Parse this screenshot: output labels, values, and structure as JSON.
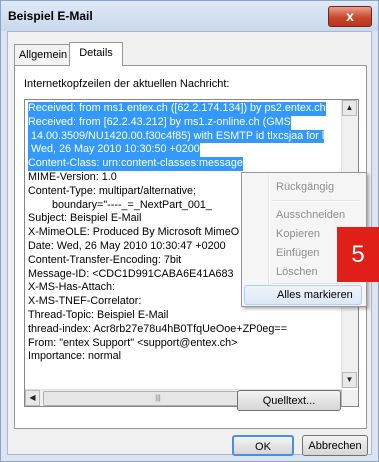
{
  "window": {
    "title": "Beispiel E-Mail",
    "close_glyph": "x"
  },
  "tabs": [
    {
      "label": "Allgemein",
      "active": false
    },
    {
      "label": "Details",
      "active": true
    }
  ],
  "details": {
    "heading": "Internetkopfzeilen der aktuellen Nachricht:",
    "header_lines": [
      "Received: from ms1.entex.ch ([62.2.174.134]) by ps2.entex.ch",
      "Received: from [62.2.43.212] by ms1.z-online.ch (GMS",
      " 14.00.3509/NU1420.00.f30c4f85) with ESMTP id tlxcsjaa for l",
      " Wed, 26 May 2010 10:30:50 +0200",
      "Content-Class: urn:content-classes:message",
      "MIME-Version: 1.0",
      "Content-Type: multipart/alternative;",
      "        boundary=\"----_=_NextPart_001_",
      "Subject: Beispiel E-Mail",
      "X-MimeOLE: Produced By Microsoft MimeO",
      "Date: Wed, 26 May 2010 10:30:47 +0200",
      "Content-Transfer-Encoding: 7bit",
      "Message-ID: <CDC1D991CABA6E41A683",
      "X-MS-Has-Attach:",
      "X-MS-TNEF-Correlator:",
      "Thread-Topic: Beispiel E-Mail",
      "thread-index: Acr8rb27e78u4hB0TfqUeOoe+ZP0eg==",
      "From: \"entex Support\" <support@entex.ch>",
      "Importance: normal"
    ],
    "source_button": "Quelltext..."
  },
  "context_menu": {
    "items": [
      {
        "label": "Rückgängig",
        "enabled": false
      },
      {
        "label": "Ausschneiden",
        "enabled": false
      },
      {
        "label": "Kopieren",
        "enabled": false
      },
      {
        "label": "Einfügen",
        "enabled": false
      },
      {
        "label": "Löschen",
        "enabled": false
      },
      {
        "label": "Alles markieren",
        "enabled": true,
        "highlighted": true
      }
    ]
  },
  "footer": {
    "ok_label": "OK",
    "cancel_label": "Abbrechen"
  },
  "annotation": {
    "step_number": "5"
  },
  "scrollbars": {
    "up": "▲",
    "down": "▼",
    "left": "◀",
    "right": "▶",
    "grip": "|||"
  },
  "colors": {
    "selection": "#3399ff",
    "close_button": "#c8482c",
    "annotation_marker": "#e02018"
  }
}
